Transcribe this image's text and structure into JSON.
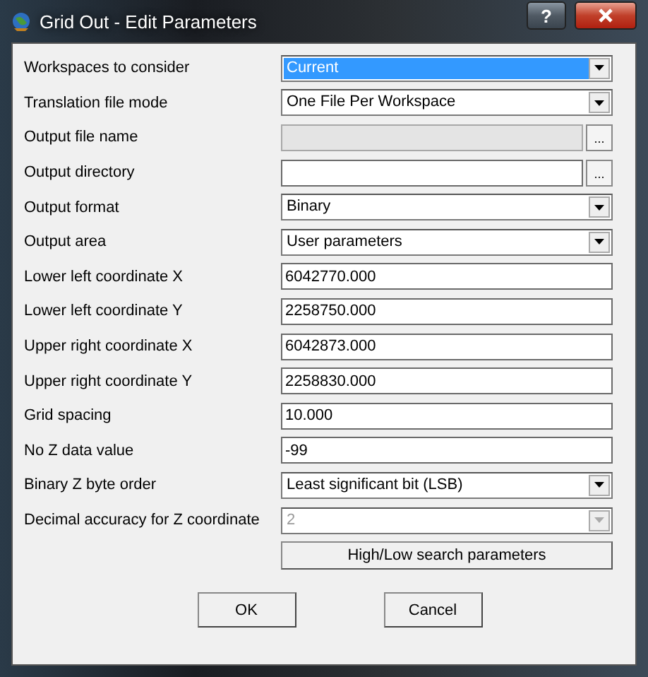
{
  "window": {
    "title": "Grid Out - Edit Parameters",
    "help_label": "?"
  },
  "rows": [
    {
      "kind": "dropdown",
      "label": "Workspaces to consider",
      "value": "Current",
      "highlighted": true,
      "disabled": false
    },
    {
      "kind": "dropdown",
      "label": "Translation file mode",
      "value": "One File Per Workspace",
      "highlighted": false,
      "disabled": false
    },
    {
      "kind": "file",
      "label": "Output file name",
      "browse_label": "...",
      "disabled": true
    },
    {
      "kind": "file",
      "label": "Output directory",
      "browse_label": "...",
      "disabled": false
    },
    {
      "kind": "dropdown",
      "label": "Output format",
      "value": "Binary",
      "highlighted": false,
      "disabled": false
    },
    {
      "kind": "dropdown",
      "label": "Output area",
      "value": "User parameters",
      "highlighted": false,
      "disabled": false
    },
    {
      "kind": "text",
      "label": "Lower left coordinate X",
      "value": "6042770.000"
    },
    {
      "kind": "text",
      "label": "Lower left coordinate Y",
      "value": "2258750.000"
    },
    {
      "kind": "text",
      "label": "Upper right coordinate X",
      "value": "6042873.000"
    },
    {
      "kind": "text",
      "label": "Upper right coordinate Y",
      "value": "2258830.000"
    },
    {
      "kind": "text",
      "label": "Grid spacing",
      "value": "10.000"
    },
    {
      "kind": "text",
      "label": "No Z data value",
      "value": "-99"
    },
    {
      "kind": "dropdown",
      "label": "Binary Z byte order",
      "value": "Least significant bit (LSB)",
      "highlighted": false,
      "disabled": false
    },
    {
      "kind": "dropdown",
      "label": "Decimal accuracy for Z coordinate",
      "value": "2",
      "highlighted": false,
      "disabled": true
    }
  ],
  "search_button": "High/Low search parameters",
  "buttons": [
    "OK",
    "Cancel"
  ]
}
